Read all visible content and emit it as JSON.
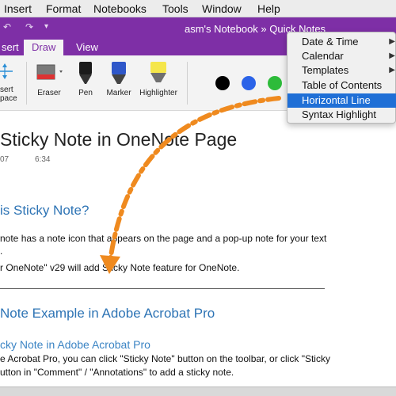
{
  "menubar": {
    "items": [
      "Insert",
      "Format",
      "Notebooks",
      "Tools",
      "Window",
      "Help"
    ]
  },
  "titlebar": {
    "breadcrumb": "asm's Notebook  »  Quick Notes"
  },
  "tabs": [
    {
      "label": "sert",
      "active": false
    },
    {
      "label": "Draw",
      "active": true
    },
    {
      "label": "View",
      "active": false
    }
  ],
  "ribbon": {
    "insert_space_label_1": "sert",
    "insert_space_label_2": "pace",
    "eraser": "Eraser",
    "pen": "Pen",
    "marker": "Marker",
    "highlighter": "Highlighter",
    "colors": [
      "#000000",
      "#2b63e8",
      "#2dbb3a"
    ]
  },
  "dropdown": {
    "items": [
      {
        "label": "Date & Time",
        "submenu": true,
        "highlighted": false
      },
      {
        "label": "Calendar",
        "submenu": true,
        "highlighted": false
      },
      {
        "label": "Templates",
        "submenu": true,
        "highlighted": false
      },
      {
        "label": "Table of Contents",
        "submenu": false,
        "highlighted": false
      },
      {
        "label": "Horizontal Line",
        "submenu": false,
        "highlighted": true
      },
      {
        "label": "Syntax Highlight",
        "submenu": false,
        "highlighted": false
      }
    ],
    "highlight_color": "#1f6fd6"
  },
  "page": {
    "title": "Sticky Note in OneNote Page",
    "date": "07",
    "time": "6:34",
    "heading1": "is Sticky Note?",
    "para1_line1": "note has a note icon that appears on the page and a pop-up note for your text",
    "para1_line2": ".",
    "para2": "r OneNote\" v29 will add Sticky Note feature for OneNote.",
    "heading2": "Note Example in Adobe Acrobat Pro",
    "subheading": "cky Note in Adobe Acrobat Pro",
    "para3_line1": "e Acrobat Pro, you can click \"Sticky Note\" button on the toolbar, or click \"Sticky",
    "para3_line2": "utton in \"Comment\" / \"Annotations\" to add a sticky note."
  },
  "accent": {
    "onenote_purple": "#7e2fa6",
    "heading_blue": "#2e74b5",
    "arrow_orange": "#ef8a1f"
  }
}
